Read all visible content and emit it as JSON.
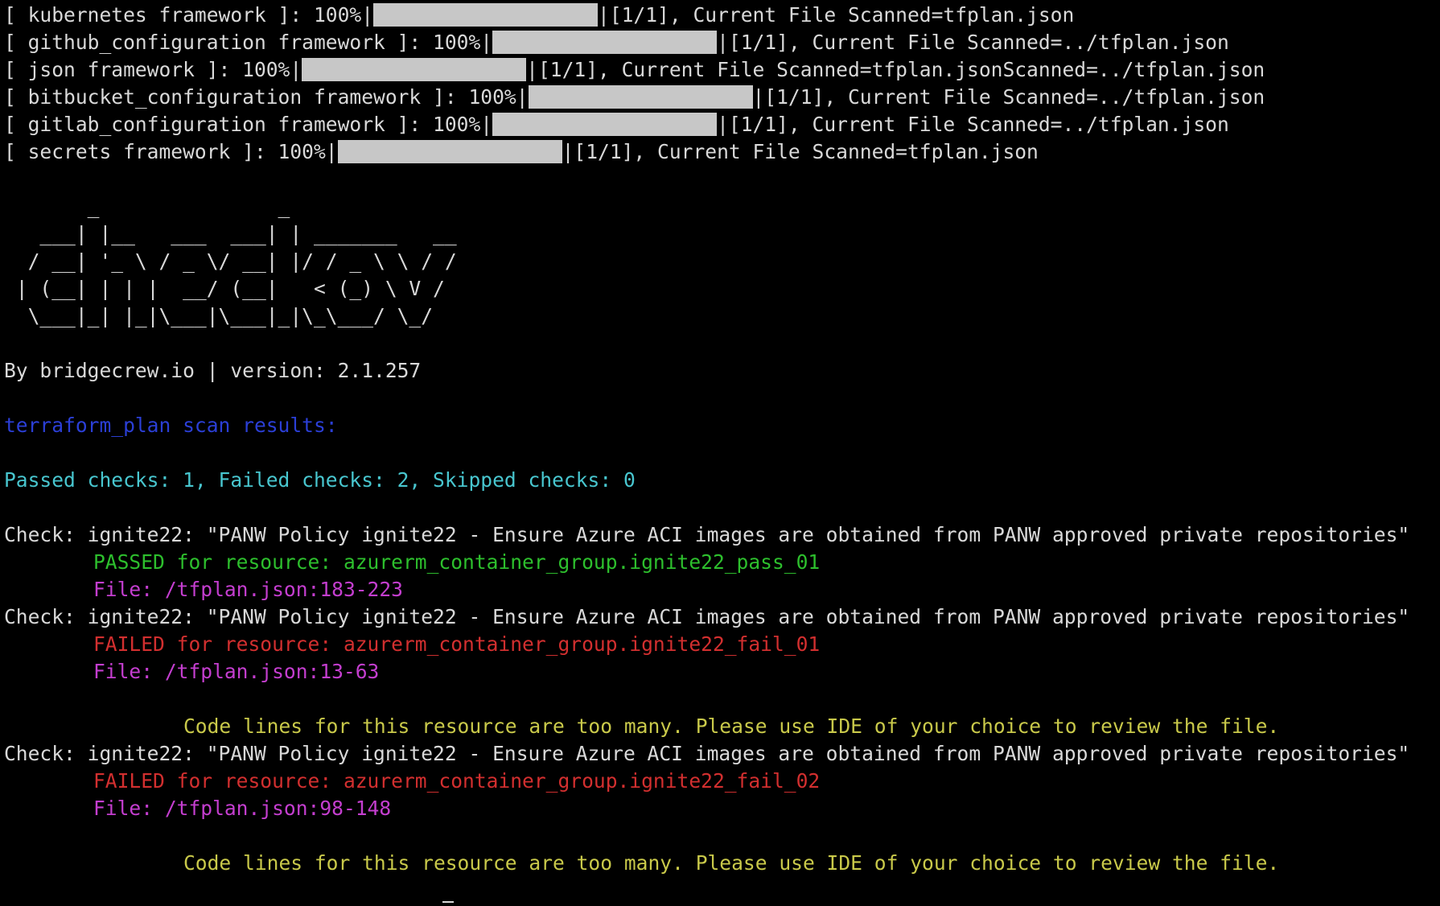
{
  "colors": {
    "background": "#000000",
    "default_text": "#d9d9d9",
    "progress_bar": "#c7c7c7",
    "section_header": "#2b3fd6",
    "summary": "#48c6cf",
    "passed": "#2dbf2d",
    "failed": "#d22f2f",
    "file": "#c43ecf",
    "note": "#c9c94a"
  },
  "progress": [
    {
      "prefix": "[ kubernetes framework ]: 100%|",
      "suffix": "|[1/1], Current File Scanned=tfplan.json",
      "fill": 1.0
    },
    {
      "prefix": "[ github_configuration framework ]: 100%|",
      "suffix": "|[1/1], Current File Scanned=../tfplan.json",
      "fill": 1.0
    },
    {
      "prefix": "[ json framework ]: 100%|",
      "suffix": "|[1/1], Current File Scanned=tfplan.jsonScanned=../tfplan.json",
      "fill": 1.0
    },
    {
      "prefix": "[ bitbucket_configuration framework ]: 100%|",
      "suffix": "|[1/1], Current File Scanned=../tfplan.json",
      "fill": 1.0
    },
    {
      "prefix": "[ gitlab_configuration framework ]: 100%|",
      "suffix": "|[1/1], Current File Scanned=../tfplan.json",
      "fill": 1.0
    },
    {
      "prefix": "[ secrets framework ]: 100%|",
      "suffix": "|[1/1], Current File Scanned=tfplan.json",
      "fill": 1.0
    }
  ],
  "banner": [
    "       _               _",
    "   ___| |__   ___  ___| | _______   __",
    "  / __| '_ \\ / _ \\/ __| |/ / _ \\ \\ / /",
    " | (__| | | |  __/ (__|   < (_) \\ V /",
    "  \\___|_| |_|\\___|\\___|_|\\_\\___/ \\_/"
  ],
  "byline": "By bridgecrew.io | version: 2.1.257",
  "section_header": "terraform_plan scan results:",
  "summary": "Passed checks: 1, Failed checks: 2, Skipped checks: 0",
  "checks": [
    {
      "title": "Check: ignite22: \"PANW Policy ignite22 - Ensure Azure ACI images are obtained from PANW approved private repositories\"",
      "status": "passed",
      "result": "PASSED for resource: azurerm_container_group.ignite22_pass_01",
      "file": "File: /tfplan.json:183-223",
      "note": ""
    },
    {
      "title": "Check: ignite22: \"PANW Policy ignite22 - Ensure Azure ACI images are obtained from PANW approved private repositories\"",
      "status": "failed",
      "result": "FAILED for resource: azurerm_container_group.ignite22_fail_01",
      "file": "File: /tfplan.json:13-63",
      "note": "Code lines for this resource are too many. Please use IDE of your choice to review the file."
    },
    {
      "title": "Check: ignite22: \"PANW Policy ignite22 - Ensure Azure ACI images are obtained from PANW approved private repositories\"",
      "status": "failed",
      "result": "FAILED for resource: azurerm_container_group.ignite22_fail_02",
      "file": "File: /tfplan.json:98-148",
      "note": "Code lines for this resource are too many. Please use IDE of your choice to review the file."
    }
  ]
}
